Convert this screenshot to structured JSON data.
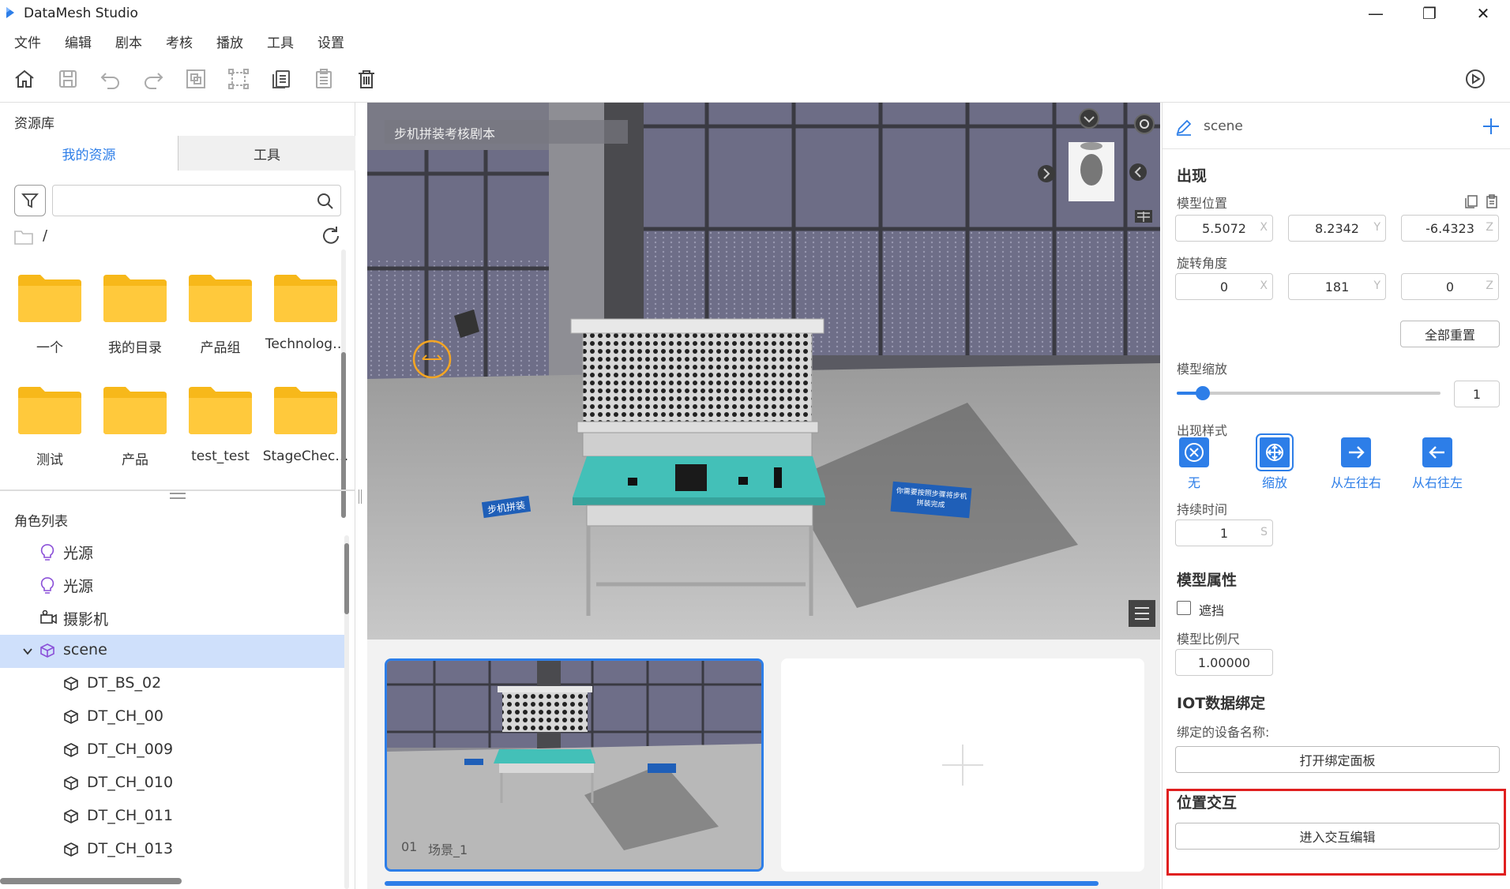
{
  "window": {
    "title": "DataMesh Studio",
    "minimize": "—",
    "maximize": "❐",
    "close": "✕"
  },
  "menu": [
    "文件",
    "编辑",
    "剧本",
    "考核",
    "播放",
    "工具",
    "设置"
  ],
  "left": {
    "library_title": "资源库",
    "tabs": [
      "我的资源",
      "工具"
    ],
    "search_placeholder": "",
    "path": "/",
    "folders": [
      "一个",
      "我的目录",
      "产品组",
      "Technolog…",
      "测试",
      "产品",
      "test_test",
      "StageChec…"
    ],
    "roles_title": "角色列表",
    "roles": [
      {
        "label": "光源",
        "icon": "bulb-icon",
        "indent": 1
      },
      {
        "label": "光源",
        "icon": "bulb-icon",
        "indent": 1
      },
      {
        "label": "摄影机",
        "icon": "camera-icon",
        "indent": 1
      },
      {
        "label": "scene",
        "icon": "cube-icon",
        "indent": 1,
        "selected": true
      },
      {
        "label": "DT_BS_02",
        "icon": "cube-icon",
        "indent": 2
      },
      {
        "label": "DT_CH_00",
        "icon": "cube-icon",
        "indent": 2
      },
      {
        "label": "DT_CH_009",
        "icon": "cube-icon",
        "indent": 2
      },
      {
        "label": "DT_CH_010",
        "icon": "cube-icon",
        "indent": 2
      },
      {
        "label": "DT_CH_011",
        "icon": "cube-icon",
        "indent": 2
      },
      {
        "label": "DT_CH_013",
        "icon": "cube-icon",
        "indent": 2
      }
    ]
  },
  "viewport": {
    "script_title": "步机拼装考核剧本",
    "sign_left": "步机拼装",
    "sign_right": "你需要按照步骤将步机拼装完成"
  },
  "timeline": {
    "scene_number": "01",
    "scene_name": "场景_1"
  },
  "right": {
    "object_name": "scene",
    "appear_title": "出现",
    "position_label": "模型位置",
    "position": {
      "x": "5.5072",
      "y": "8.2342",
      "z": "-6.4323"
    },
    "rotation_label": "旋转角度",
    "rotation": {
      "x": "0",
      "y": "181",
      "z": "0"
    },
    "axis": {
      "x": "X",
      "y": "Y",
      "z": "Z"
    },
    "reset_all": "全部重置",
    "scale_label": "模型缩放",
    "scale_value": "1",
    "scale_level": 0.1,
    "style_label": "出现样式",
    "styles": [
      "无",
      "缩放",
      "从左往右",
      "从右往左"
    ],
    "duration_label": "持续时间",
    "duration_value": "1",
    "duration_unit": "S",
    "attr_title": "模型属性",
    "occlude_label": "遮挡",
    "ratio_label": "模型比例尺",
    "ratio_value": "1.00000",
    "iot_title": "IOT数据绑定",
    "device_label": "绑定的设备名称:",
    "open_binding": "打开绑定面板",
    "interact_title": "位置交互",
    "enter_interact": "进入交互编辑"
  },
  "colors": {
    "accent": "#2d7ee8",
    "highlight": "#e02020",
    "selected_row": "#cfe0fb",
    "folder": "#f7b81a"
  }
}
